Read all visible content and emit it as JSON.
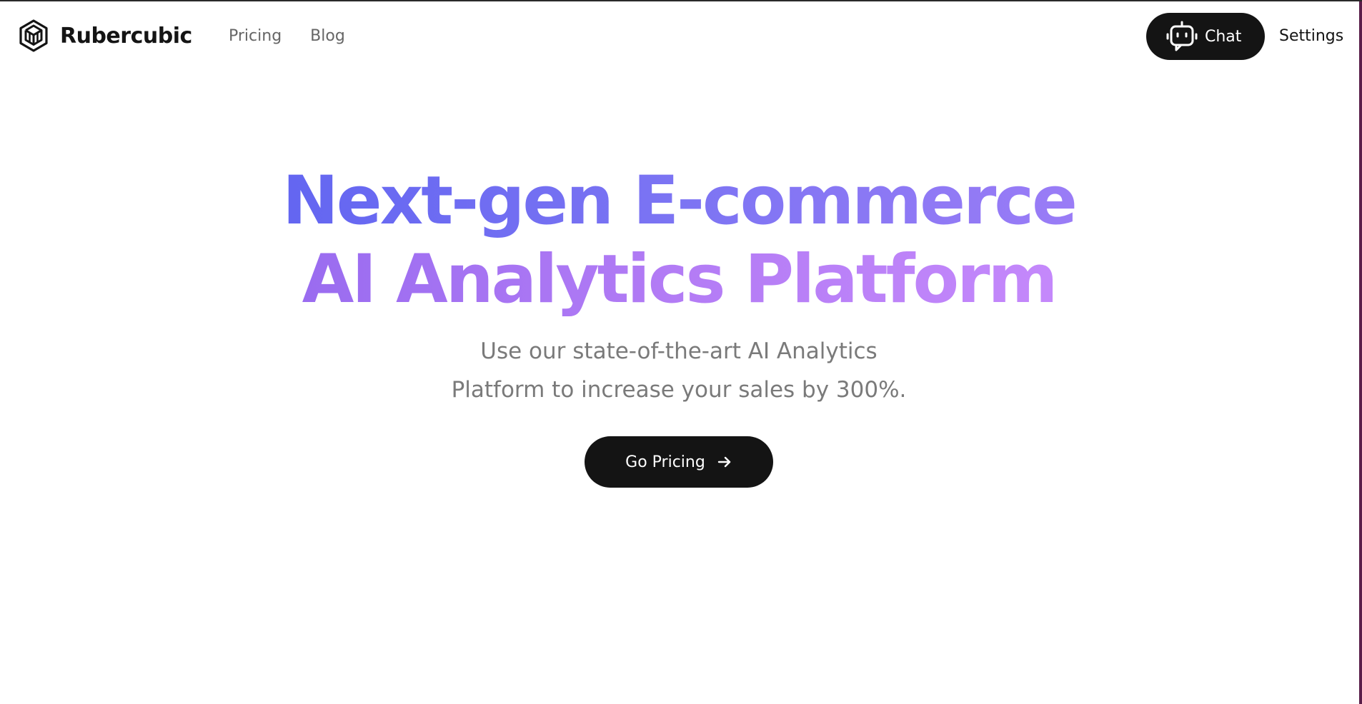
{
  "header": {
    "brand_name": "Rubercubic",
    "logo_icon": "cube-logo-icon",
    "nav": [
      {
        "label": "Pricing"
      },
      {
        "label": "Blog"
      }
    ],
    "chat_button": {
      "label": "Chat",
      "icon": "robot-icon"
    },
    "settings_label": "Settings"
  },
  "hero": {
    "title_line_1": "Next-gen E-commerce",
    "title_line_2": "AI Analytics Platform",
    "subtitle_line_1": "Use our state-of-the-art AI Analytics",
    "subtitle_line_2": "Platform to increase your sales by 300%.",
    "cta": {
      "label": "Go Pricing",
      "icon": "arrow-right-icon"
    }
  },
  "colors": {
    "primary_dark": "#141414",
    "gradient_start": "#6366f1",
    "gradient_end": "#c084fc",
    "muted_text": "#7a7a7a",
    "nav_text": "#666666"
  }
}
